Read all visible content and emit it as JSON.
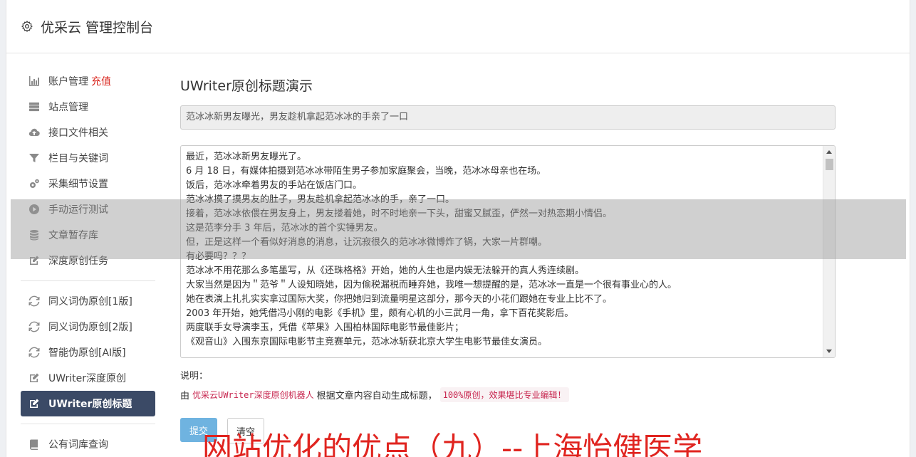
{
  "header": {
    "title": "优采云 管理控制台",
    "icon": "gear-icon"
  },
  "sidebar": {
    "group1": [
      {
        "label": "账户管理",
        "badge": "充值",
        "icon": "bar-chart-icon"
      },
      {
        "label": "站点管理",
        "icon": "server-icon"
      },
      {
        "label": "接口文件相关",
        "icon": "cloud-upload-icon"
      },
      {
        "label": "栏目与关键词",
        "icon": "filter-icon"
      },
      {
        "label": "采集细节设置",
        "icon": "cogs-icon"
      },
      {
        "label": "手动运行测试",
        "icon": "play-circle-icon"
      },
      {
        "label": "文章暂存库",
        "icon": "database-icon"
      },
      {
        "label": "深度原创任务",
        "icon": "edit-icon"
      }
    ],
    "group2": [
      {
        "label": "同义词伪原创[1版]",
        "icon": "refresh-icon"
      },
      {
        "label": "同义词伪原创[2版]",
        "icon": "refresh-icon"
      },
      {
        "label": "智能伪原创[AI版]",
        "icon": "refresh-icon"
      },
      {
        "label": "UWriter深度原创",
        "icon": "edit-icon"
      },
      {
        "label": "UWriter原创标题",
        "icon": "edit-icon",
        "active": true
      }
    ],
    "group3": [
      {
        "label": "公有词库查询",
        "icon": "book-icon"
      }
    ]
  },
  "main": {
    "heading": "UWriter原创标题演示",
    "title_value": "范冰冰新男友曝光，男友趁机拿起范冰冰的手亲了一口",
    "content_lines": [
      "最近，范冰冰新男友曝光了。",
      "6 月 18 日，有媒体拍摄到范冰冰带陌生男子参加家庭聚会，当晚，范冰冰母亲也在场。",
      "饭后，范冰冰牵着男友的手站在饭店门口。",
      "范冰冰摸了摸男友的肚子，男友趁机拿起范冰冰的手，亲了一口。",
      "接着，范冰冰依偎在男友身上，男友搂着她，时不时地亲一下头，甜蜜又腻歪，俨然一对热恋期小情侣。",
      "这是范李分手 3 年后，范冰冰的首个实锤男友。",
      "但，正是这样一个看似好消息的消息，让沉寂很久的范冰冰微博炸了锅，大家一片群嘲。",
      "有必要吗？？？",
      "范冰冰不用花那么多笔墨写，从《还珠格格》开始，她的人生也是内娱无法躲开的真人秀连续剧。",
      "大家当然是因为＂范爷＂人设知晓她，因为偷税漏税而睡弃她，我唯一想提醒的是，范冰冰一直是一个很有事业心的人。",
      "她在表演上扎扎实实拿过国际大奖，你把她归到流量明星这部分，那今天的小花们跟她在专业上比不了。",
      "2003 年开始，她凭借冯小刚的电影《手机》里，颇有心机的小三武月一角，拿下百花奖影后。",
      "两度联手女导演李玉，凭借《苹果》入围柏林国际电影节最佳影片；",
      "《观音山》入围东京国际电影节主竞赛单元，范冰冰斩获北京大学生电影节最佳女演员。"
    ],
    "note_label": "说明：",
    "note_prefix": "由",
    "note_code1": "优采云UWriter深度原创机器人",
    "note_middle": "根据文章内容自动生成标题，",
    "note_code2": "100%原创，效果堪比专业编辑！",
    "submit_label": "提交",
    "clear_label": "清空"
  },
  "overlay": {
    "text": "网站优化的优点（九）--上海怡健医学"
  },
  "colors": {
    "active_nav": "#3b4a66",
    "primary_button": "#6fb3e0",
    "badge": "#d9241c",
    "overlay_text": "#e0241f"
  }
}
